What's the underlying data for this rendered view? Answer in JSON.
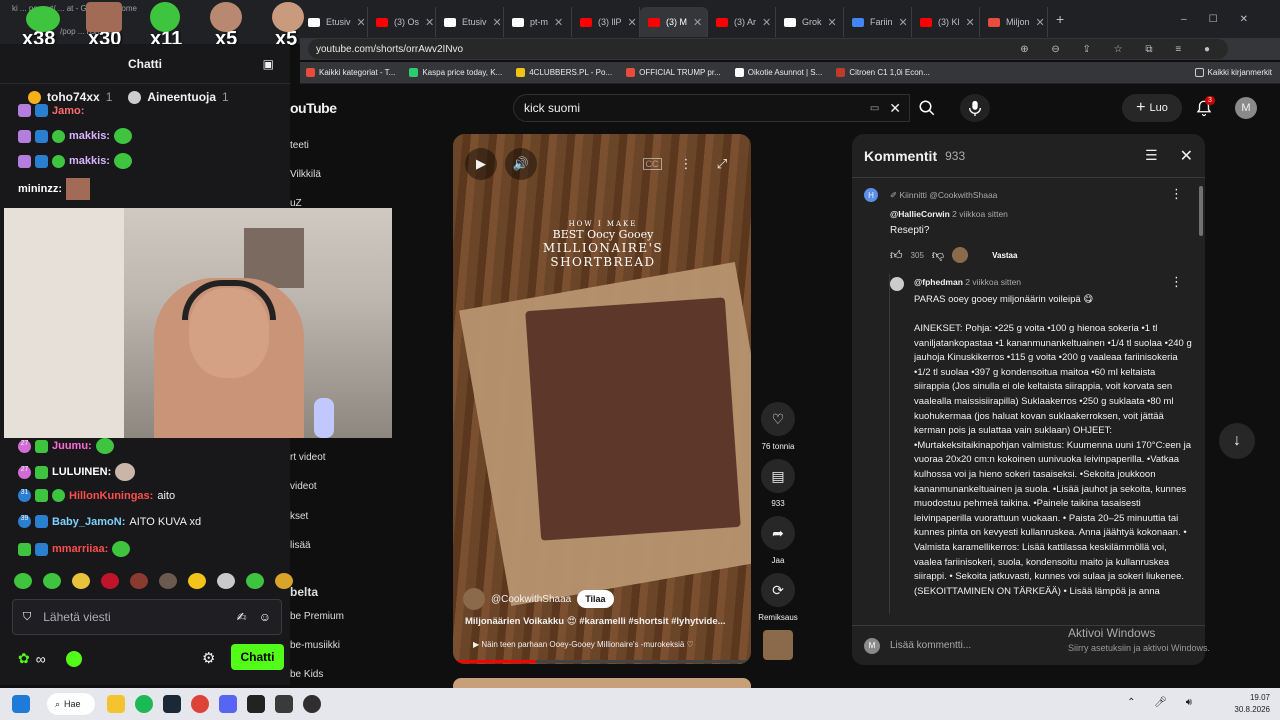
{
  "browser": {
    "tabs": [
      {
        "label": "Etusiv",
        "color": "#ffffff"
      },
      {
        "label": "(3) Os",
        "color": "#ff0000"
      },
      {
        "label": "Etusiv",
        "color": "#ffffff"
      },
      {
        "label": "pt-m",
        "color": "#ffffff"
      },
      {
        "label": "(3) llP",
        "color": "#ff0000"
      },
      {
        "label": "(3) M",
        "color": "#ff0000"
      },
      {
        "label": "(3) Ar",
        "color": "#ff0000"
      },
      {
        "label": "Grok",
        "color": "#ffffff"
      },
      {
        "label": "Fariin",
        "color": "#4285f4"
      },
      {
        "label": "(3) Kl",
        "color": "#ff0000"
      },
      {
        "label": "Miljon",
        "color": "#e74c3c"
      }
    ],
    "url": "youtube.com/shorts/orrAwv2INvo",
    "bookmarks": [
      {
        "label": "Kaikki kategoriat - T...",
        "color": "#e74c3c"
      },
      {
        "label": "Kaspa price today, K...",
        "color": "#2ecc71"
      },
      {
        "label": "4CLUBBERS.PL - Po...",
        "color": "#f1c40f"
      },
      {
        "label": "OFFICIAL TRUMP pr...",
        "color": "#e74c3c"
      },
      {
        "label": "Oikotie Asunnot | S...",
        "color": "#ffffff"
      },
      {
        "label": "Citroen C1 1,0i Econ...",
        "color": "#c0392b"
      }
    ],
    "bookmarks_right": "Kaikki kirjanmerkit"
  },
  "youtube": {
    "logo": "ouTube",
    "search_value": "kick suomi",
    "create_label": "Luo",
    "notifications": "3",
    "avatar_letter": "M",
    "sidebar": [
      "teeti",
      "Vilkkilä",
      "uZ",
      "rt videot",
      "videot",
      "kset",
      "lisää",
      "belta",
      "be Premium",
      "be-musiikki",
      "be Kids"
    ],
    "video": {
      "overlay_line1": "HOW I MAKE",
      "overlay_line2": "BEST Oocy Gooey",
      "overlay_line3": "MILLIONAIRE'S",
      "overlay_line4": "SHORTBREAD",
      "channel": "@CookwithShaaa",
      "subscribe": "Tilaa",
      "description": "Miljonäärien Voikakku 😍 #karamelli #shortsit #lyhytvide...",
      "sub_line": "Näin teen parhaan Ooey-Gooey Millionaire's -murokeksiä ♡",
      "progress": 0.28
    },
    "actions": {
      "likes": "76 tonnia",
      "comments": "933",
      "share": "Jaa",
      "remix": "Remiksaus"
    },
    "comments": {
      "title": "Kommentit",
      "count": "933",
      "pinned": "Kiinnitti @CookwithShaaa",
      "c1_author": "@HallieCorwin",
      "c1_time": "2 viikkoa sitten",
      "c1_text": "Resepti?",
      "c1_likes": "305",
      "reply_label": "Vastaa",
      "c2_author": "@fphedman",
      "c2_time": "2 viikkoa sitten",
      "c2_line1": "PARAS ooey gooey miljonäärin voileipä 😋",
      "c2_body": "AINEKSET: Pohja: •225 g voita •100 g hienoa sokeria •1 tl vaniljatankopastaa •1 kananmunankeltuainen •1/4 tl suolaa •240 g jauhoja Kinuskikerros •115 g voita •200 g vaaleaa fariinisokeria •1/2 tl suolaa •397 g kondensoitua maitoa •60 ml keltaista siirappia (Jos sinulla ei ole keltaista siirappia, voit korvata sen vaalealla maissisiirapilla) Suklaakerros •250 g suklaata •80 ml kuohukermaa (jos haluat kovan suklaakerroksen, voit jättää kerman pois ja sulattaa vain suklaan) OHJEET: •Murtakeksitaikinapohjan valmistus: Kuumenna uuni 170°C:een ja vuoraa 20x20 cm:n kokoinen uunivuoka leivinpaperilla. •Vatkaa kulhossa voi ja hieno sokeri tasaiseksi. •Sekoita joukkoon kananmunankeltuainen ja suola. •Lisää jauhot ja sekoita, kunnes muodostuu pehmeä taikina. •Painele taikina tasaisesti leivinpaperilla vuorattuun vuokaan. • Paista 20–25 minuuttia tai kunnes pinta on kevyesti kullanruskea. Anna jäähtyä kokonaan. • Valmista karamellikerros: Lisää kattilassa keskilämmöllä voi, vaalea fariinisokeri, suola, kondensoitu maito ja kullanruskea siirappi. • Sekoita jatkuvasti, kunnes voi sulaa ja sokeri liukenee. (SEKOITTAMINEN ON TÄRKEÄÄ) • Lisää lämpöä ja anna",
      "input_placeholder": "Lisää kommentti...",
      "avatar_letter": "M",
      "pinned_avatar": "H"
    },
    "windows_watermark_1": "Aktivoi Windows",
    "windows_watermark_2": "Siirry asetuksiin ja aktivoi Windows."
  },
  "overlay": {
    "counters": [
      "x38",
      "x30",
      "x11",
      "x5",
      "x5"
    ],
    "chrome_title": "ki ... popout/ ... at - Google Chrome",
    "url_partial": "/pop ... hs/chat"
  },
  "chat": {
    "title": "Chatti",
    "top1_name": "toho74xx",
    "top1_count": "1",
    "top2_name": "Aineentuoja",
    "top2_count": "1",
    "messages_top": [
      {
        "user": "Jamo:",
        "text": "",
        "color": "#ff6b6b"
      },
      {
        "user": "makkis:",
        "text": "",
        "color": "#d8b4fe"
      },
      {
        "user": "makkis:",
        "text": "",
        "color": "#d8b4fe"
      },
      {
        "user": "mininzz:",
        "text": "",
        "color": "#ffffff"
      }
    ],
    "messages_bottom": [
      {
        "badge": "27",
        "user": "Juumu:",
        "text": "",
        "color": "#ff6bd6"
      },
      {
        "badge": "27",
        "user": "LULUINEN:",
        "text": "",
        "color": "#ffffff"
      },
      {
        "badge": "31",
        "user": "HillonKuningas:",
        "text": "aito",
        "color": "#ff4d4d"
      },
      {
        "badge": "39",
        "user": "Baby_JamoN:",
        "text": "AITO KUVA xd",
        "color": "#7dd3fc"
      },
      {
        "badge": "",
        "user": "mmarriiaa:",
        "text": "",
        "color": "#ff4d4d"
      }
    ],
    "input_placeholder": "Lähetä viesti",
    "send_label": "Chatti",
    "viewers": "∞"
  },
  "taskbar": {
    "search_label": "Hae",
    "time": "19.07",
    "date": "30.8.2026"
  }
}
